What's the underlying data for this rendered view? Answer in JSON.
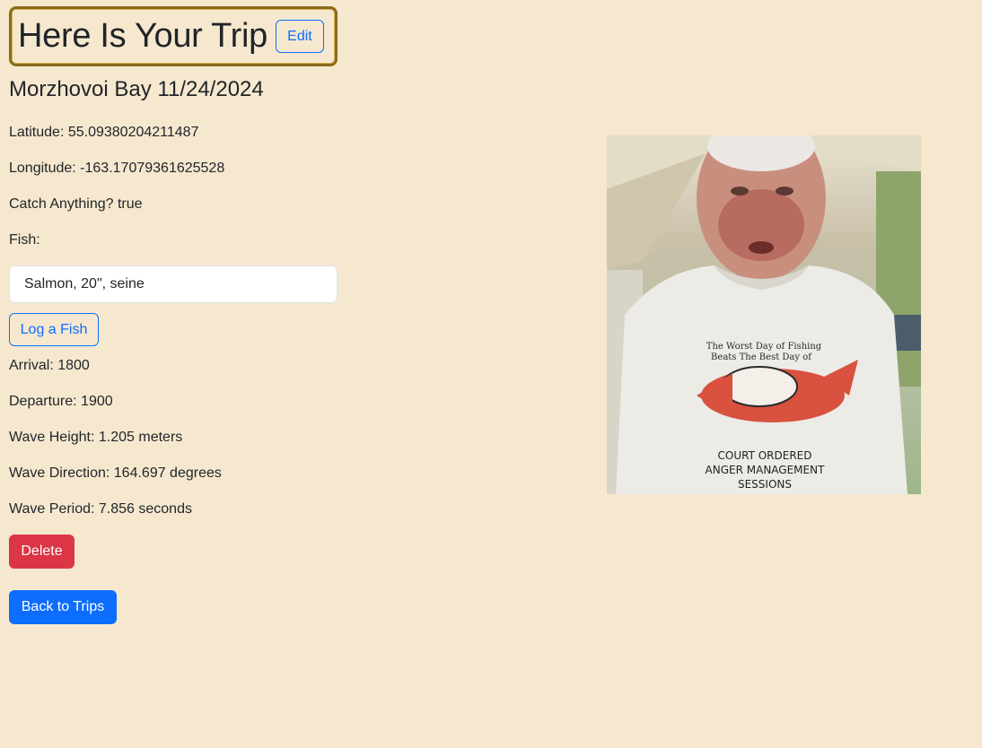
{
  "header": {
    "title": "Here Is Your Trip",
    "edit_label": "Edit"
  },
  "trip": {
    "location_date": "Morzhovoi Bay 11/24/2024",
    "latitude": "Latitude: 55.09380204211487",
    "longitude": "Longitude: -163.17079361625528",
    "catch": "Catch Anything? true",
    "fish_label": "Fish:",
    "fish": [
      "Salmon, 20\", seine"
    ],
    "log_fish_label": "Log a Fish",
    "arrival": "Arrival: 1800",
    "departure": "Departure: 1900",
    "wave_height": "Wave Height: 1.205 meters",
    "wave_direction": "Wave Direction: 164.697 degrees",
    "wave_period": "Wave Period: 7.856 seconds"
  },
  "actions": {
    "delete_label": "Delete",
    "back_label": "Back to Trips"
  },
  "photo": {
    "shirt_line1": "The Worst Day of Fishing",
    "shirt_line2": "Beats The Best Day of",
    "shirt_line3": "COURT ORDERED",
    "shirt_line4": "ANGER MANAGEMENT",
    "shirt_line5": "SESSIONS"
  },
  "colors": {
    "background": "#f6e8cf",
    "primary": "#0d6efd",
    "danger": "#dc3545",
    "title_border": "#8a6a1c"
  }
}
